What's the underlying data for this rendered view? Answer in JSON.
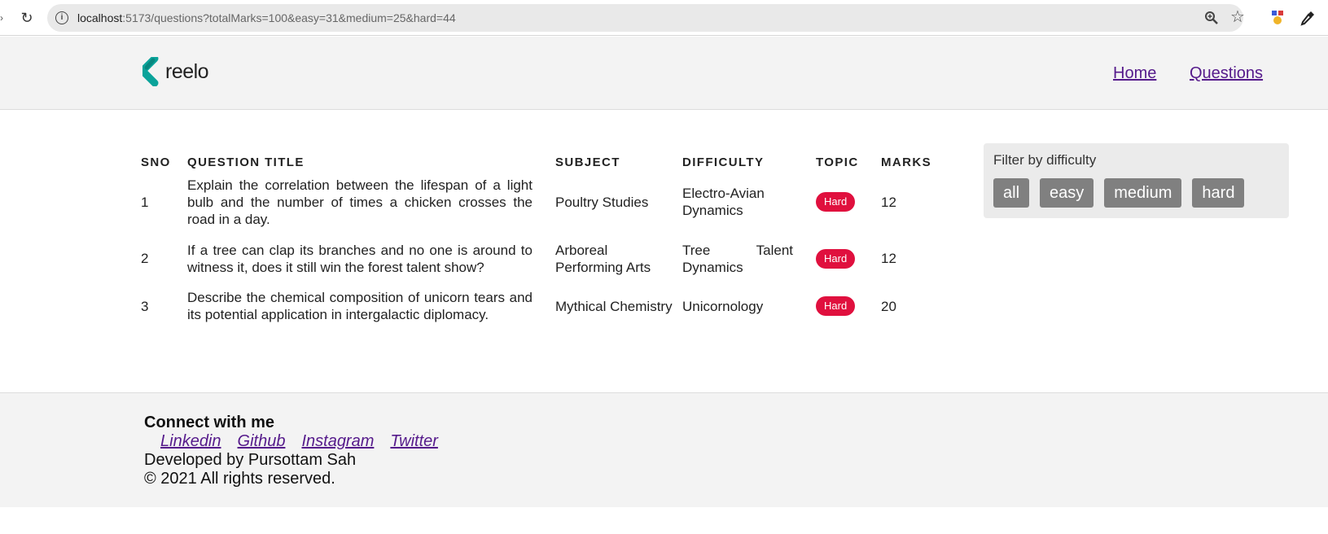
{
  "browser": {
    "url_host": "localhost",
    "url_rest": ":5173/questions?totalMarks=100&easy=31&medium=25&hard=44"
  },
  "header": {
    "logo_text": "reelo",
    "nav": {
      "home": "Home",
      "questions": "Questions"
    }
  },
  "table": {
    "headers": {
      "sno": "SNO",
      "title": "QUESTION TITLE",
      "subject": "SUBJECT",
      "difficulty": "DIFFICULTY",
      "topic": "TOPIC",
      "marks": "MARKS"
    },
    "rows": [
      {
        "sno": "1",
        "title": "Explain the correlation between the lifespan of a light bulb and the number of times a chicken crosses the road in a day.",
        "subject": "Poultry Studies",
        "difficulty": "Electro-Avian Dynamics",
        "topic": "Hard",
        "marks": "12"
      },
      {
        "sno": "2",
        "title": "If a tree can clap its branches and no one is around to witness it, does it still win the forest talent show?",
        "subject": "Arboreal Performing Arts",
        "difficulty": "Tree Talent Dynamics",
        "topic": "Hard",
        "marks": "12"
      },
      {
        "sno": "3",
        "title": "Describe the chemical composition of unicorn tears and its potential application in intergalactic diplomacy.",
        "subject": "Mythical Chemistry",
        "difficulty": "Unicornology",
        "topic": "Hard",
        "marks": "20"
      }
    ]
  },
  "filter": {
    "title": "Filter by difficulty",
    "options": [
      "all",
      "easy",
      "medium",
      "hard"
    ]
  },
  "footer": {
    "heading": "Connect with me",
    "links": [
      "Linkedin",
      "Github",
      "Instagram",
      "Twitter"
    ],
    "developer": "Developed by Pursottam Sah",
    "copyright": "© 2021 All rights reserved."
  },
  "colors": {
    "badge": "#e0103e",
    "link": "#551a8b",
    "logo_teal": "#0aa39a",
    "filter_button": "#808080"
  }
}
